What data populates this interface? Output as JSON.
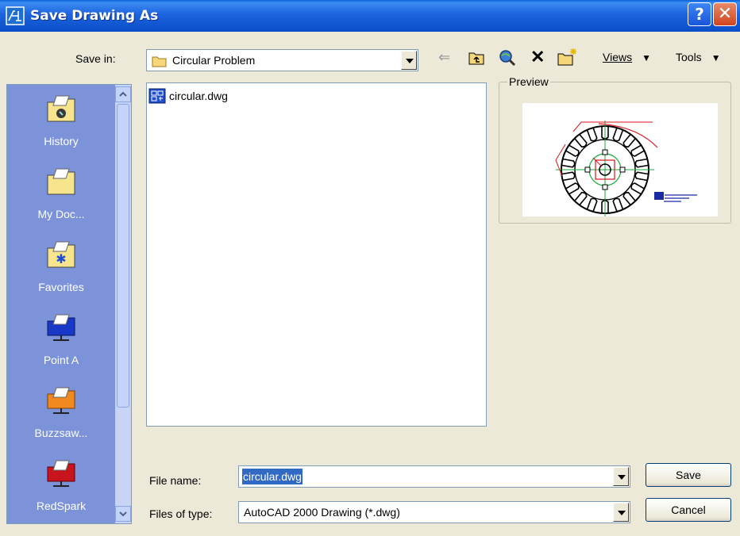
{
  "window": {
    "title": "Save Drawing As"
  },
  "save_in": {
    "label": "Save in:",
    "value": "Circular Problem"
  },
  "toolbar": {
    "views_label": "Views",
    "tools_label": "Tools"
  },
  "places": [
    {
      "label": "History"
    },
    {
      "label": "My Doc..."
    },
    {
      "label": "Favorites"
    },
    {
      "label": "Point A"
    },
    {
      "label": "Buzzsaw..."
    },
    {
      "label": "RedSpark"
    }
  ],
  "files": [
    {
      "name": "circular.dwg"
    }
  ],
  "preview": {
    "title": "Preview"
  },
  "file_name": {
    "label": "File name:",
    "value": "circular.dwg"
  },
  "file_type": {
    "label": "Files of type:",
    "value": "AutoCAD 2000 Drawing (*.dwg)"
  },
  "buttons": {
    "save": "Save",
    "cancel": "Cancel"
  },
  "colors": {
    "title_bar": "#1d63df",
    "places_bar": "#7c93d9",
    "dialog_bg": "#ece9d8"
  }
}
